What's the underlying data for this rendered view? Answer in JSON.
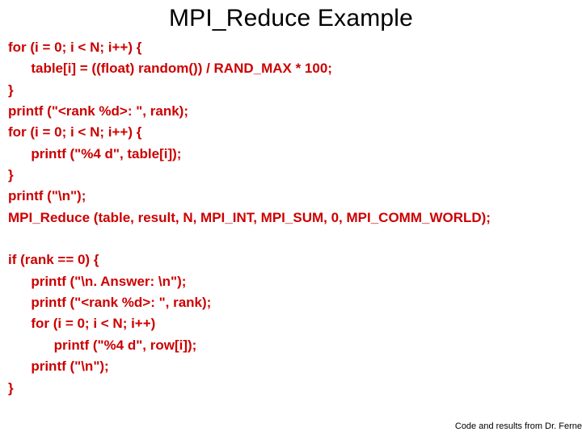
{
  "title": "MPI_Reduce Example",
  "code": "for (i = 0; i < N; i++) {\n      table[i] = ((float) random()) / RAND_MAX * 100;\n}\nprintf (\"<rank %d>: \", rank);\nfor (i = 0; i < N; i++) {\n      printf (\"%4 d\", table[i]);\n}\nprintf (\"\\n\");\nMPI_Reduce (table, result, N, MPI_INT, MPI_SUM, 0, MPI_COMM_WORLD);\n\nif (rank == 0) {\n      printf (\"\\n. Answer: \\n\");\n      printf (\"<rank %d>: \", rank);\n      for (i = 0; i < N; i++)\n            printf (\"%4 d\", row[i]);\n      printf (\"\\n\");\n}",
  "footer": "Code and results from Dr. Ferne"
}
